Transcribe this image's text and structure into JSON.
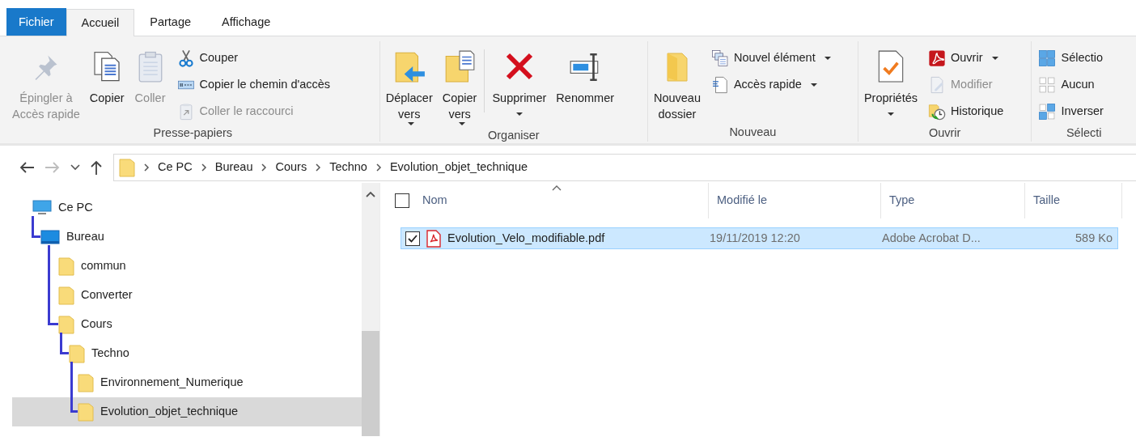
{
  "ribbon_tabs": [
    {
      "label": "Fichier",
      "kind": "file",
      "selected": false
    },
    {
      "label": "Accueil",
      "kind": "tab",
      "selected": true
    },
    {
      "label": "Partage",
      "kind": "tab",
      "selected": false
    },
    {
      "label": "Affichage",
      "kind": "tab",
      "selected": false
    }
  ],
  "ribbon": {
    "groups": [
      {
        "label": "Presse-papiers",
        "items": [
          {
            "kind": "large",
            "label": "Épingler à\nAccès rapide",
            "disabled": true,
            "dropdown": false
          },
          {
            "kind": "large",
            "label": "Copier",
            "disabled": false,
            "dropdown": false
          },
          {
            "kind": "large",
            "label": "Coller",
            "disabled": true,
            "dropdown": false
          },
          {
            "kind": "stack",
            "items": [
              {
                "label": "Couper",
                "disabled": false,
                "dropdown": false
              },
              {
                "label": "Copier le chemin d'accès",
                "disabled": false,
                "dropdown": false
              },
              {
                "label": "Coller le raccourci",
                "disabled": true,
                "dropdown": false
              }
            ]
          }
        ]
      },
      {
        "label": "Organiser",
        "items": [
          {
            "kind": "large",
            "label": "Déplacer\nvers",
            "disabled": false,
            "dropdown": true
          },
          {
            "kind": "large",
            "label": "Copier\nvers",
            "disabled": false,
            "dropdown": true
          },
          {
            "kind": "divider"
          },
          {
            "kind": "large",
            "label": "Supprimer",
            "disabled": false,
            "dropdown": true
          },
          {
            "kind": "large",
            "label": "Renommer",
            "disabled": false,
            "dropdown": false
          }
        ]
      },
      {
        "label": "Nouveau",
        "items": [
          {
            "kind": "large",
            "label": "Nouveau\ndossier",
            "disabled": false,
            "dropdown": false
          },
          {
            "kind": "stack",
            "items": [
              {
                "label": "Nouvel élément",
                "disabled": false,
                "dropdown": true
              },
              {
                "label": "Accès rapide",
                "disabled": false,
                "dropdown": true
              }
            ]
          }
        ]
      },
      {
        "label": "Ouvrir",
        "items": [
          {
            "kind": "large",
            "label": "Propriétés",
            "disabled": false,
            "dropdown": true
          },
          {
            "kind": "stack",
            "items": [
              {
                "label": "Ouvrir",
                "disabled": false,
                "dropdown": true
              },
              {
                "label": "Modifier",
                "disabled": true,
                "dropdown": false
              },
              {
                "label": "Historique",
                "disabled": false,
                "dropdown": false
              }
            ]
          }
        ]
      },
      {
        "label": "Sélecti",
        "items": [
          {
            "kind": "stack",
            "items": [
              {
                "label": "Sélectio",
                "disabled": false,
                "dropdown": false
              },
              {
                "label": "Aucun",
                "disabled": false,
                "dropdown": false
              },
              {
                "label": "Inverser",
                "disabled": false,
                "dropdown": false
              }
            ]
          }
        ]
      }
    ]
  },
  "address_bar": {
    "back_disabled": false,
    "forward_disabled": true,
    "breadcrumb": [
      "Ce PC",
      "Bureau",
      "Cours",
      "Techno",
      "Evolution_objet_technique"
    ]
  },
  "navigation_tree": [
    {
      "label": "Ce PC",
      "selected": false,
      "children": [
        {
          "label": "Bureau",
          "selected": false,
          "children": [
            {
              "label": "commun",
              "selected": false
            },
            {
              "label": "Converter",
              "selected": false
            },
            {
              "label": "Cours",
              "selected": false,
              "children": [
                {
                  "label": "Techno",
                  "selected": false,
                  "children": [
                    {
                      "label": "Environnement_Numerique",
                      "selected": false
                    },
                    {
                      "label": "Evolution_objet_technique",
                      "selected": true
                    }
                  ]
                }
              ]
            }
          ]
        }
      ]
    }
  ],
  "file_list": {
    "select_all_checked": false,
    "columns": [
      {
        "label": "Nom",
        "sorted": true
      },
      {
        "label": "Modifié le",
        "sorted": false
      },
      {
        "label": "Type",
        "sorted": false
      },
      {
        "label": "Taille",
        "sorted": false
      }
    ],
    "rows": [
      {
        "name": "Evolution_Velo_modifiable.pdf",
        "modified": "19/11/2019 12:20",
        "type": "Adobe Acrobat D...",
        "size": "589 Ko",
        "selected": true,
        "checked": true
      }
    ]
  }
}
